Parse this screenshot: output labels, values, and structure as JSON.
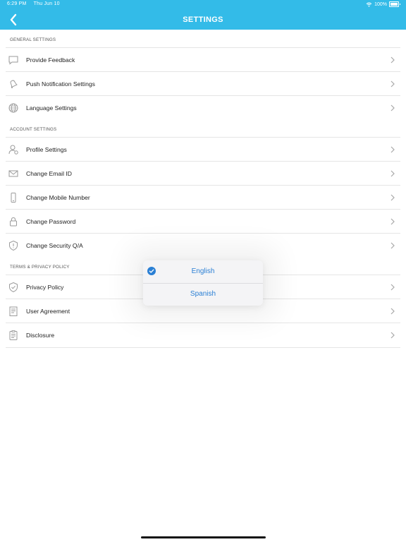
{
  "status_bar": {
    "time": "6:29 PM",
    "date": "Thu Jun 10",
    "battery": "100%"
  },
  "header": {
    "title": "SETTINGS"
  },
  "sections": [
    {
      "title": "GENERAL SETTINGS",
      "items": [
        {
          "label": "Provide Feedback",
          "icon": "feedback-icon"
        },
        {
          "label": "Push Notification Settings",
          "icon": "bell-icon"
        },
        {
          "label": "Language Settings",
          "icon": "globe-icon"
        }
      ]
    },
    {
      "title": "ACCOUNT SETTINGS",
      "items": [
        {
          "label": "Profile Settings",
          "icon": "profile-icon"
        },
        {
          "label": "Change Email ID",
          "icon": "mail-icon"
        },
        {
          "label": "Change Mobile Number",
          "icon": "phone-icon"
        },
        {
          "label": "Change Password",
          "icon": "lock-icon"
        },
        {
          "label": "Change Security Q/A",
          "icon": "shield-icon"
        }
      ]
    },
    {
      "title": "TERMS & PRIVACY POLICY",
      "items": [
        {
          "label": "Privacy Policy",
          "icon": "shield-check-icon"
        },
        {
          "label": "User Agreement",
          "icon": "document-icon"
        },
        {
          "label": "Disclosure",
          "icon": "clipboard-icon"
        }
      ]
    }
  ],
  "language_popup": {
    "options": [
      {
        "label": "English",
        "selected": true
      },
      {
        "label": "Spanish",
        "selected": false
      }
    ]
  },
  "colors": {
    "accent": "#33bbe8",
    "link": "#2a7fd4"
  }
}
